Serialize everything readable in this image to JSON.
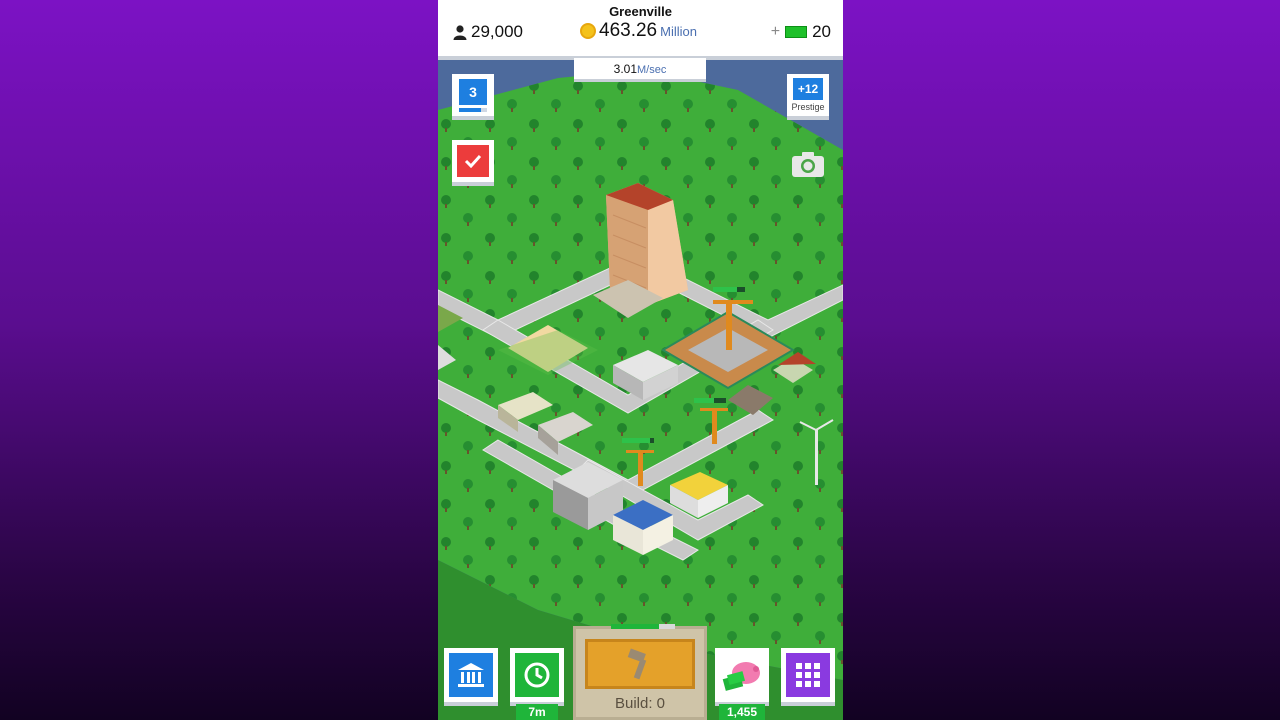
{
  "hud": {
    "city_name": "Greenville",
    "population": "29,000",
    "money_value": "463.26",
    "money_unit": "Million",
    "cash_plus": "+",
    "cash_value": "20",
    "rate_value": "3.01",
    "rate_unit": "M/sec"
  },
  "side": {
    "level": "3",
    "level_progress": 0.8,
    "prestige_count": "+12",
    "prestige_label": "Prestige"
  },
  "bottom": {
    "timer_badge": "7m",
    "build_label": "Build: 0",
    "piggy_badge": "1,455"
  },
  "icons": [
    "person-icon",
    "coin-icon",
    "cash-icon",
    "checkmark-icon",
    "key-icon",
    "camera-icon",
    "bank-icon",
    "clock-icon",
    "hammer-icon",
    "piggy-bank-icon",
    "grid-icon"
  ],
  "colors": {
    "accent_blue": "#1e7fe0",
    "accent_green": "#1fb53a",
    "task_red": "#ec3c3c",
    "menu_purple": "#8a3ae0",
    "build_orange": "#e4a12a"
  }
}
